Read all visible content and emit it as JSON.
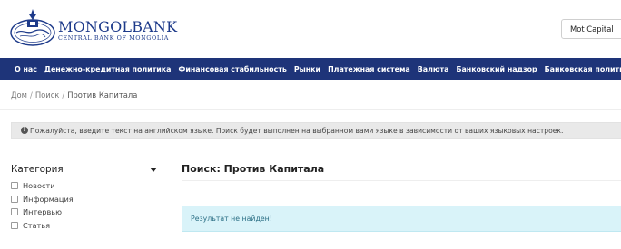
{
  "header": {
    "brand_name": "MONGOLBANK",
    "brand_subtitle": "CENTRAL BANK OF MONGOLIA",
    "logo_icon": "mongolbank-seal-icon",
    "search_value": "Mot Capital"
  },
  "nav": {
    "items": [
      {
        "label": "О нас"
      },
      {
        "label": "Денежно-кредитная политика"
      },
      {
        "label": "Финансовая стабильность"
      },
      {
        "label": "Рынки"
      },
      {
        "label": "Платежная система"
      },
      {
        "label": "Валюта"
      },
      {
        "label": "Банковский надзор"
      },
      {
        "label": "Банковская политика и урегулирование"
      }
    ]
  },
  "breadcrumb": {
    "items": [
      "Дом",
      "Поиск",
      "Против Капитала"
    ],
    "separator": "/"
  },
  "notice": {
    "icon": "info-icon",
    "text": "Пожалуйста, введите текст на английском языке. Поиск будет выполнен на выбранном вами языке в зависимости от ваших языковых настроек."
  },
  "sidebar": {
    "title": "Категория",
    "toggle_icon": "chevron-down-icon",
    "items": [
      {
        "label": "Новости",
        "checked": false
      },
      {
        "label": "Информация",
        "checked": false
      },
      {
        "label": "Интервью",
        "checked": false
      },
      {
        "label": "Статья",
        "checked": false
      }
    ]
  },
  "main": {
    "title": "Поиск: Против Капитала",
    "result_message": "Результат не найден!"
  },
  "colors": {
    "nav_bg": "#1e3479",
    "brand": "#1d3a8a",
    "result_bg": "#d9f3f9",
    "result_text": "#2b6f85"
  }
}
